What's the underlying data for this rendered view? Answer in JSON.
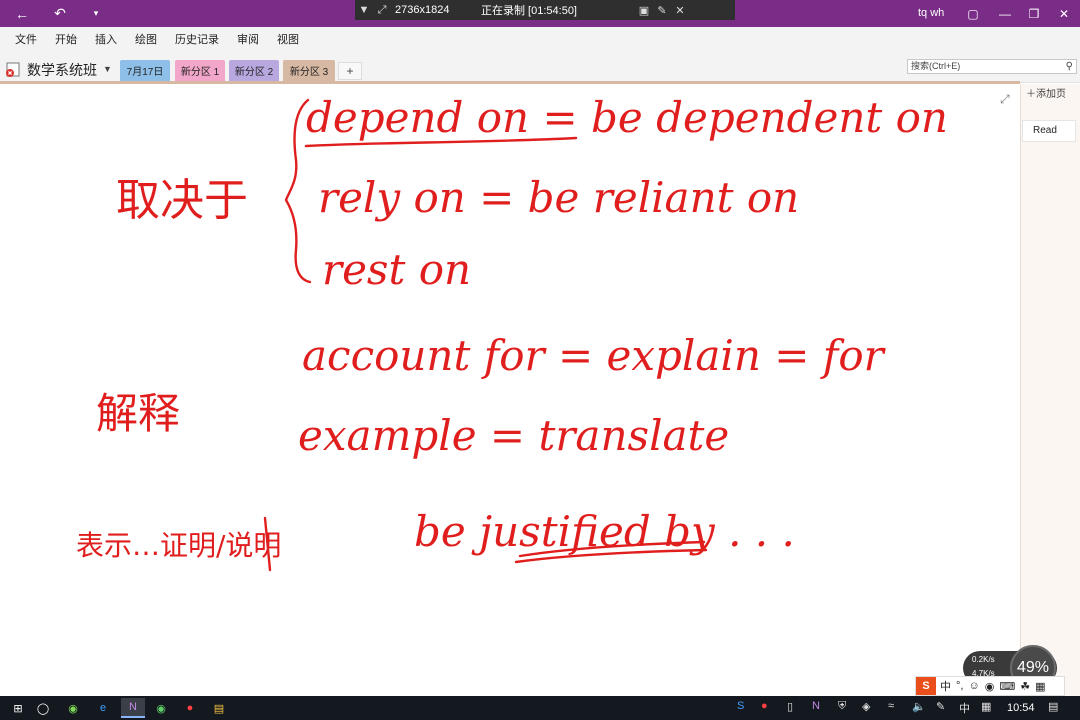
{
  "titlebar": {
    "recorder_resolution": "2736x1824",
    "recorder_status": "正在录制 [01:54:50]",
    "user": "tq wh"
  },
  "menu": [
    "文件",
    "开始",
    "插入",
    "绘图",
    "历史记录",
    "审阅",
    "视图"
  ],
  "notebook": {
    "title": "数学系统班",
    "sections": [
      {
        "label": "7月17日",
        "color": "#8ebfe8"
      },
      {
        "label": "新分区 1",
        "color": "#f2a6c9"
      },
      {
        "label": "新分区 2",
        "color": "#b9a8e0"
      },
      {
        "label": "新分区 3",
        "color": "#d7b8a3"
      }
    ],
    "add_tab": "+"
  },
  "search": {
    "placeholder": "搜索(Ctrl+E)"
  },
  "pages": {
    "add_page": "添加页",
    "items": [
      "Read"
    ]
  },
  "ink": {
    "line1": "depend on = be dependent on",
    "line2": "rely on = be reliant on",
    "line3": "rest on",
    "line4": "account for = explain = for",
    "line5": "example = translate",
    "line6": "be justified by . . .",
    "label_depend": "取决于",
    "label_explain": "解释",
    "label_prove": "表示…证明/说明"
  },
  "netwidget": {
    "up": "0.2K/s",
    "down": "4.7K/s",
    "percent": "49%"
  },
  "ime": {
    "mode": "中",
    "punct": "°,"
  },
  "taskbar": {
    "clock": "10:54",
    "lang": "中"
  }
}
